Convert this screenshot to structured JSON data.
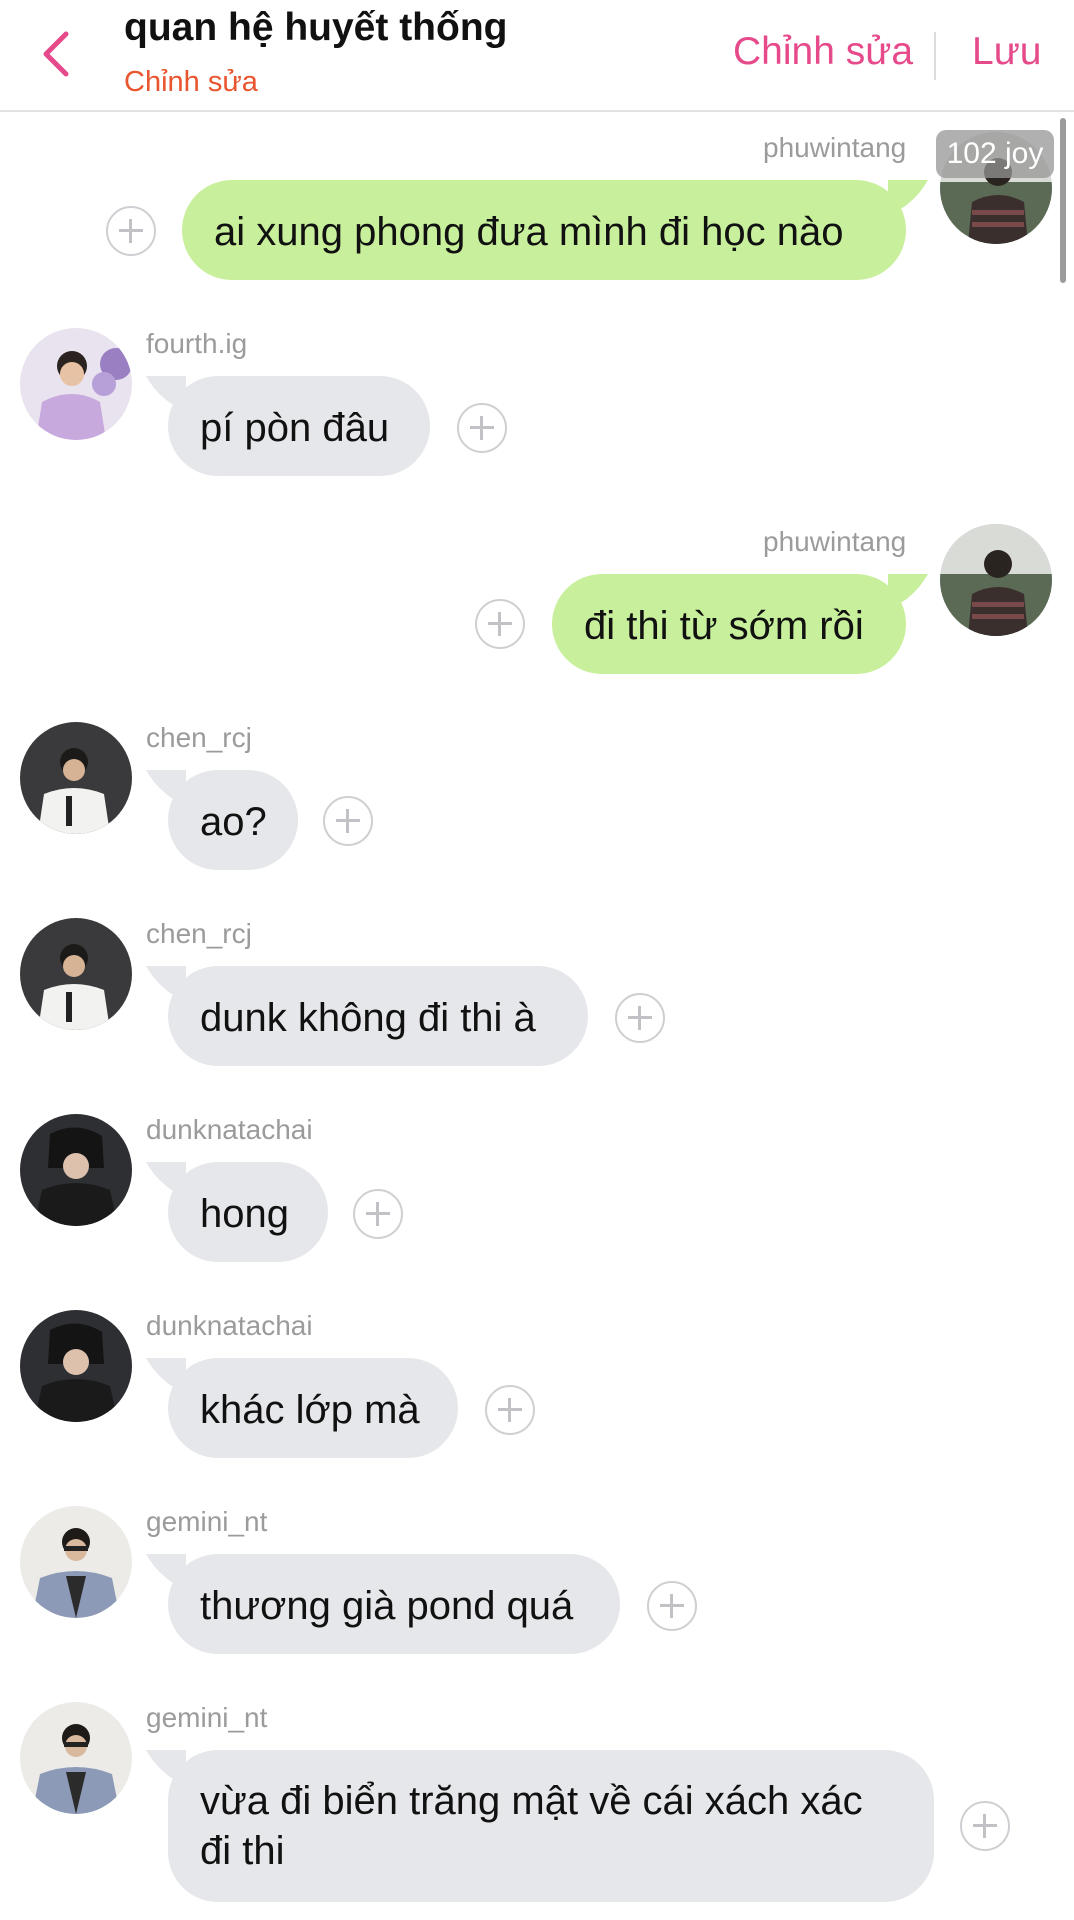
{
  "header": {
    "title": "quan hệ huyết thống",
    "subtitle": "Chỉnh sửa",
    "edit_label": "Chỉnh sửa",
    "save_label": "Lưu",
    "accent_color": "#e64a8a",
    "subtitle_color": "#e9552e"
  },
  "badge": {
    "text": "102 joy"
  },
  "colors": {
    "outgoing_bubble": "#c8ef9b",
    "incoming_bubble": "#e6e7ea",
    "username": "#9b9b9b"
  },
  "messages": [
    {
      "user": "phuwintang",
      "text": "ai xung phong đưa mình đi học nào",
      "side": "right"
    },
    {
      "user": "fourth.ig",
      "text": "pí pòn đâu",
      "side": "left"
    },
    {
      "user": "phuwintang",
      "text": "đi thi từ sớm rồi",
      "side": "right"
    },
    {
      "user": "chen_rcj",
      "text": "ao?",
      "side": "left"
    },
    {
      "user": "chen_rcj",
      "text": "dunk không đi thi à",
      "side": "left"
    },
    {
      "user": "dunknatachai",
      "text": "hong",
      "side": "left"
    },
    {
      "user": "dunknatachai",
      "text": "khác lớp mà",
      "side": "left"
    },
    {
      "user": "gemini_nt",
      "text": "thương già pond quá",
      "side": "left"
    },
    {
      "user": "gemini_nt",
      "text": "vừa đi biển trăng mật về cái xách xác",
      "text2": "đi thi",
      "side": "left"
    }
  ]
}
